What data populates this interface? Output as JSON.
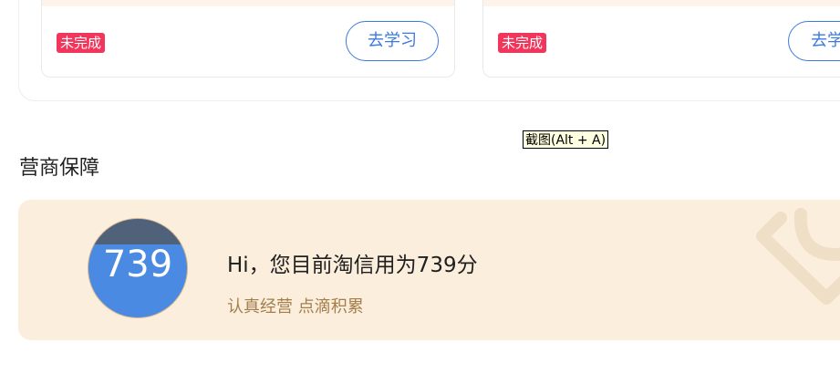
{
  "courses": [
    {
      "status": "未完成",
      "action_label": "去学习"
    },
    {
      "status": "未完成",
      "action_label": "去学"
    }
  ],
  "tooltip": {
    "text": "截图(Alt + A)"
  },
  "section": {
    "title": "营商保障"
  },
  "credit": {
    "score": "739",
    "message": "Hi，您目前淘信用为739分",
    "slogan": "认真经营 点滴积累"
  },
  "colors": {
    "badge_red": "#f2355a",
    "button_blue": "#3a7be0",
    "banner_bg": "#fbeedd",
    "circle_blue": "#4a8ae3",
    "slogan_brown": "#a37e4a"
  }
}
